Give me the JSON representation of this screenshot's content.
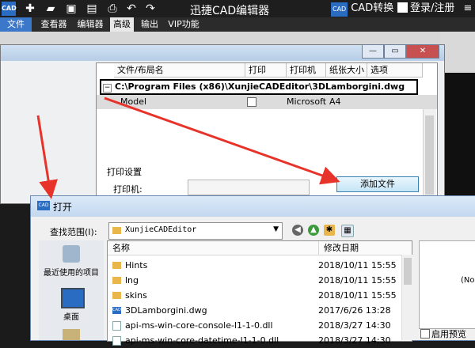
{
  "app": {
    "logo_text": "CAD",
    "title": "迅捷CAD编辑器",
    "cad_convert_badge": "CAD",
    "cad_convert_label": "CAD转换",
    "login_label": "登录/注册",
    "toolbar_icons": [
      "new-icon",
      "open-folder-icon",
      "save-icon",
      "save-as-icon",
      "print-icon",
      "undo-icon",
      "redo-icon"
    ]
  },
  "menu": {
    "tabs": [
      "文件",
      "查看器",
      "编辑器",
      "高级",
      "输出",
      "VIP功能"
    ],
    "active": "高级"
  },
  "print_dialog": {
    "columns": [
      "文件/布局名",
      "打印",
      "打印机",
      "纸张大小",
      "选项"
    ],
    "path_expander": "−",
    "path": "C:\\Program Files (x86)\\XunjieCADEditor\\3DLamborgini.dwg",
    "model_row": {
      "name": "Model",
      "printer": "Microsoft",
      "paper": "A4"
    },
    "print_settings_label": "打印设置",
    "printer_label": "打印机:",
    "add_file_button": "添加文件"
  },
  "open_dialog": {
    "title": "打开",
    "icon_text": "CAD",
    "look_in_label": "查找范围(I):",
    "look_in_value": "XunjieCADEditor",
    "places": [
      "最近使用的项目",
      "桌面"
    ],
    "columns": [
      "名称",
      "修改日期"
    ],
    "files": [
      {
        "name": "Hints",
        "date": "2018/10/11 15:55",
        "type": "folder"
      },
      {
        "name": "lng",
        "date": "2018/10/11 15:55",
        "type": "folder"
      },
      {
        "name": "skins",
        "date": "2018/10/11 15:55",
        "type": "folder"
      },
      {
        "name": "3DLamborgini.dwg",
        "date": "2017/6/26 13:28",
        "type": "dwg"
      },
      {
        "name": "api-ms-win-core-console-l1-1-0.dll",
        "date": "2018/3/27 14:30",
        "type": "dll"
      },
      {
        "name": "api-ms-win-core-datetime-l1-1-0.dll",
        "date": "2018/3/27 14:30",
        "type": "dll"
      }
    ],
    "preview_text": "(No",
    "enable_preview_label": "启用预览"
  },
  "colors": {
    "accent_blue": "#2a6cc2",
    "annotation_red": "#e8332b"
  }
}
